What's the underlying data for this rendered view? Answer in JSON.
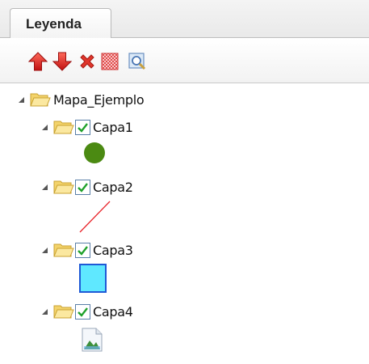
{
  "panel": {
    "tab_label": "Leyenda"
  },
  "toolbar": {
    "buttons": [
      {
        "icon": "move-up-icon",
        "color": "#d9241c"
      },
      {
        "icon": "move-down-icon",
        "color": "#d9241c"
      },
      {
        "icon": "delete-icon",
        "color": "#d9241c"
      },
      {
        "icon": "transparency-icon",
        "color": "#e05050"
      },
      {
        "icon": "zoom-to-layer-icon",
        "color": "#5a86c0"
      }
    ]
  },
  "tree": {
    "root": {
      "label": "Mapa_Ejemplo",
      "expanded": true
    },
    "layers": [
      {
        "label": "Capa1",
        "checked": true,
        "symbol": "point",
        "symbol_color": "#4b8a12"
      },
      {
        "label": "Capa2",
        "checked": true,
        "symbol": "line",
        "symbol_color": "#e8242a"
      },
      {
        "label": "Capa3",
        "checked": true,
        "symbol": "polygon",
        "symbol_color": "#5fe8ff",
        "stroke_color": "#1f59d6"
      },
      {
        "label": "Capa4",
        "checked": true,
        "symbol": "image"
      }
    ]
  }
}
